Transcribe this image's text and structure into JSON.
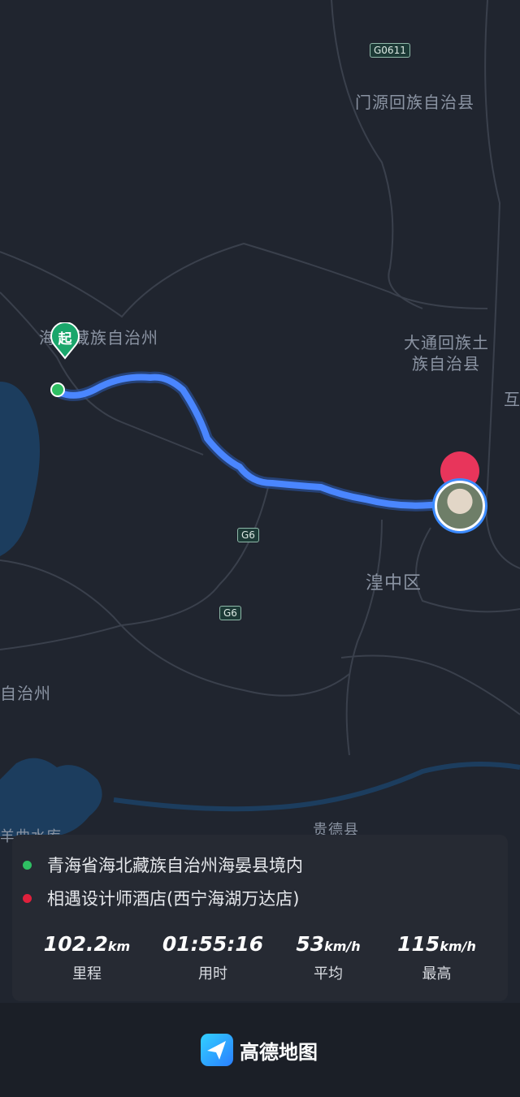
{
  "map": {
    "places": {
      "menyuan": "门源回族自治县",
      "haibei": "海北藏族自治州",
      "datong_line1": "大通回族土",
      "datong_line2": "族自治县",
      "huangzhong": "湟中区",
      "zizhizhou": "自治州",
      "guide": "贵德县",
      "yangqu": "羊曲水库",
      "edge_hu": "互"
    },
    "roads": {
      "g0611": "G0611",
      "g6_a": "G6",
      "g6_b": "G6"
    },
    "start_marker": "起",
    "colors": {
      "route": "#4a86ff",
      "start": "#2fbf63",
      "end": "#e0203c",
      "water": "#1c3d5e"
    }
  },
  "trip": {
    "start_address": "青海省海北藏族自治州海晏县境内",
    "end_address": "相遇设计师酒店(西宁海湖万达店)",
    "stats": [
      {
        "value": "102.2",
        "unit": "km",
        "label": "里程"
      },
      {
        "value": "01:55:16",
        "unit": "",
        "label": "用时"
      },
      {
        "value": "53",
        "unit": "km/h",
        "label": "平均"
      },
      {
        "value": "115",
        "unit": "km/h",
        "label": "最高"
      }
    ]
  },
  "brand": {
    "name": "高德地图",
    "icon": "gaode-logo-icon"
  }
}
